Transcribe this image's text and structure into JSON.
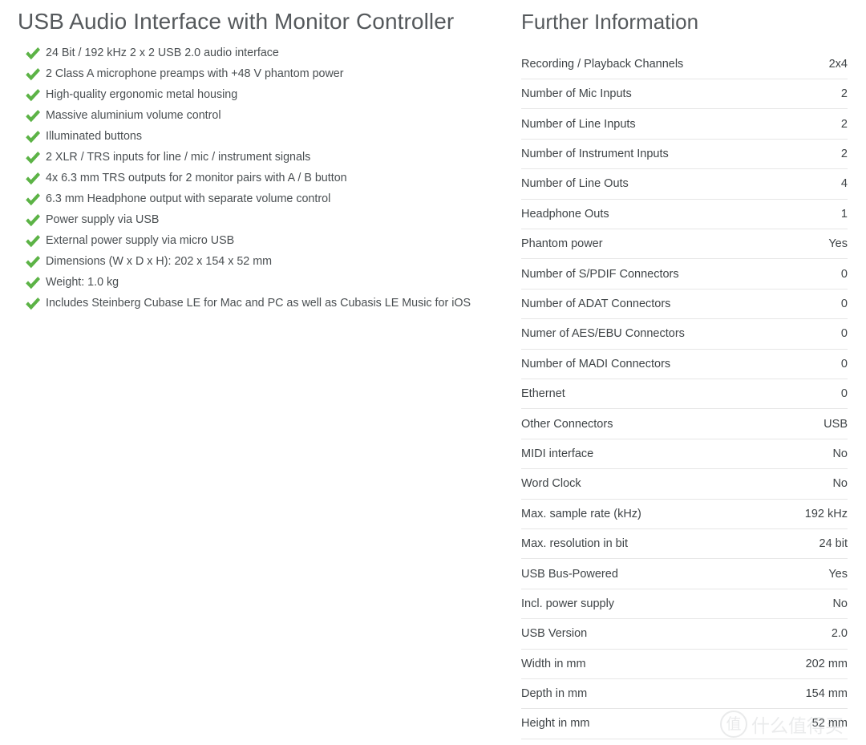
{
  "left": {
    "title": "USB Audio Interface with Monitor Controller",
    "bullet_icon": "check-icon",
    "check_color": "#5cb346",
    "features": [
      "24 Bit / 192 kHz 2 x 2 USB 2.0 audio interface",
      "2 Class A microphone preamps with +48 V phantom power",
      "High-quality ergonomic metal housing",
      "Massive aluminium volume control",
      "Illuminated buttons",
      "2 XLR / TRS inputs for line / mic / instrument signals",
      "4x 6.3 mm TRS outputs for 2 monitor pairs with A / B button",
      "6.3 mm Headphone output with separate volume control",
      "Power supply via USB",
      "External power supply via micro USB",
      "Dimensions (W x D x H): 202 x 154 x 52 mm",
      "Weight: 1.0 kg",
      "Includes Steinberg Cubase LE for Mac and PC as well as Cubasis LE Music for iOS"
    ]
  },
  "right": {
    "title": "Further Information",
    "specs": [
      {
        "label": "Recording / Playback Channels",
        "value": "2x4"
      },
      {
        "label": "Number of Mic Inputs",
        "value": "2"
      },
      {
        "label": "Number of Line Inputs",
        "value": "2"
      },
      {
        "label": "Number of Instrument Inputs",
        "value": "2"
      },
      {
        "label": "Number of Line Outs",
        "value": "4"
      },
      {
        "label": "Headphone Outs",
        "value": "1"
      },
      {
        "label": "Phantom power",
        "value": "Yes"
      },
      {
        "label": "Number of S/PDIF Connectors",
        "value": "0"
      },
      {
        "label": "Number of ADAT Connectors",
        "value": "0"
      },
      {
        "label": "Numer of AES/EBU Connectors",
        "value": "0"
      },
      {
        "label": "Number of MADI Connectors",
        "value": "0"
      },
      {
        "label": "Ethernet",
        "value": "0"
      },
      {
        "label": "Other Connectors",
        "value": "USB"
      },
      {
        "label": "MIDI interface",
        "value": "No"
      },
      {
        "label": "Word Clock",
        "value": "No"
      },
      {
        "label": "Max. sample rate (kHz)",
        "value": "192 kHz"
      },
      {
        "label": "Max. resolution in bit",
        "value": "24 bit"
      },
      {
        "label": "USB Bus-Powered",
        "value": "Yes"
      },
      {
        "label": "Incl. power supply",
        "value": "No"
      },
      {
        "label": "USB Version",
        "value": "2.0"
      },
      {
        "label": "Width in mm",
        "value": "202 mm"
      },
      {
        "label": "Depth in mm",
        "value": "154 mm"
      },
      {
        "label": "Height in mm",
        "value": "52 mm"
      }
    ]
  },
  "watermark": {
    "logo_glyph": "值",
    "text": "什么值得买"
  }
}
